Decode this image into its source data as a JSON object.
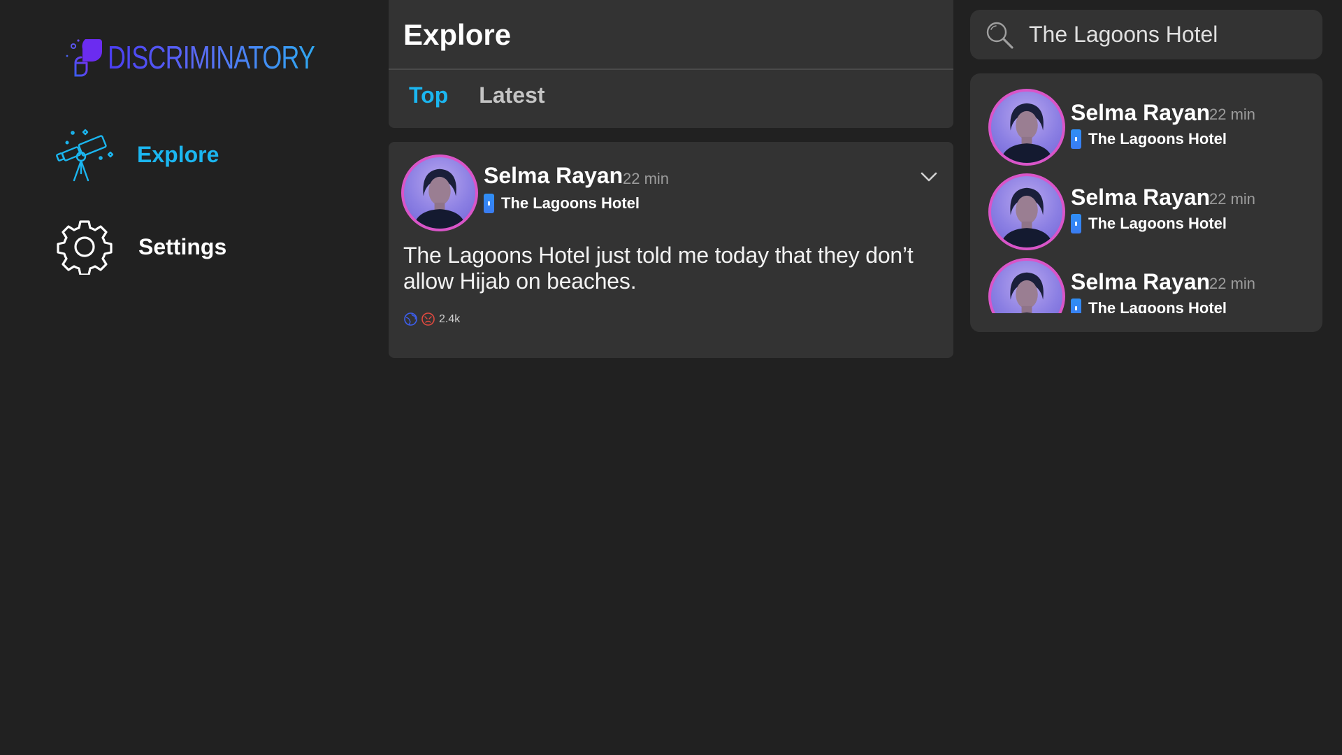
{
  "app": {
    "logo_text": "DISCRIMINATORY",
    "colors": {
      "background": "#212121",
      "card": "#333333",
      "accent": "#1bb6f0",
      "avatar_ring": "#d955c8",
      "logo_purple": "#6b3df0",
      "place_icon": "#2f8ff5"
    }
  },
  "sidebar": {
    "items": [
      {
        "label": "Explore",
        "icon": "telescope-icon",
        "active": true
      },
      {
        "label": "Settings",
        "icon": "gear-icon",
        "active": false
      }
    ]
  },
  "header": {
    "title": "Explore",
    "tabs": [
      {
        "label": "Top",
        "active": true
      },
      {
        "label": "Latest",
        "active": false
      }
    ]
  },
  "post": {
    "author": "Selma Rayan",
    "time": "22 min",
    "place": "The Lagoons Hotel",
    "text": "The Lagoons Hotel just told me today that they don’t allow Hijab on beaches.",
    "reaction_count": "2.4k"
  },
  "search": {
    "value": "The Lagoons Hotel"
  },
  "results": [
    {
      "author": "Selma Rayan",
      "time": "22 min",
      "place": "The Lagoons Hotel"
    },
    {
      "author": "Selma Rayan",
      "time": "22 min",
      "place": "The Lagoons Hotel"
    },
    {
      "author": "Selma Rayan",
      "time": "22 min",
      "place": "The Lagoons Hotel"
    }
  ]
}
